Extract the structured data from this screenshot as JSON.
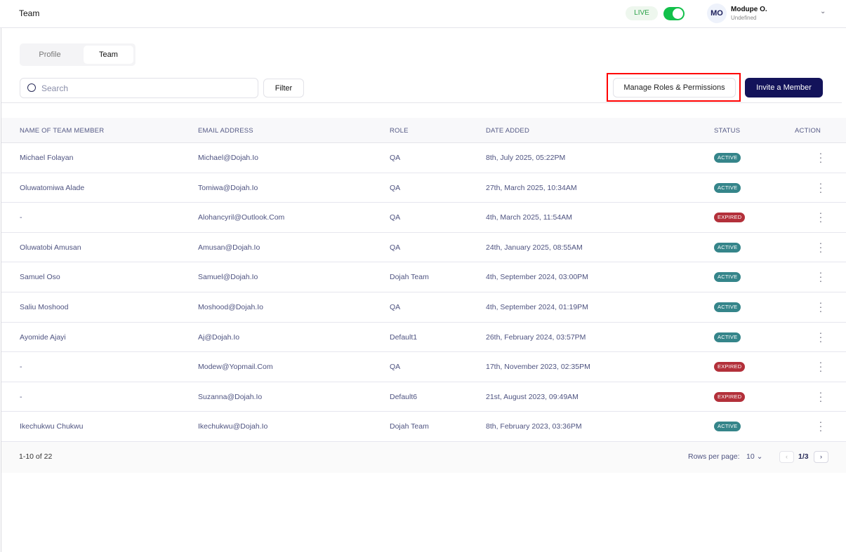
{
  "header": {
    "title": "Team",
    "env_label": "LIVE",
    "env_on": true,
    "user_initials": "MO",
    "user_name": "Modupe O.",
    "user_role": "Undefined"
  },
  "tabs": [
    {
      "label": "Profile",
      "active": false
    },
    {
      "label": "Team",
      "active": true
    }
  ],
  "toolbar": {
    "search_placeholder": "Search",
    "filter_label": "Filter",
    "manage_label": "Manage Roles & Permissions",
    "invite_label": "Invite a Member"
  },
  "table": {
    "columns": [
      "NAME OF TEAM MEMBER",
      "EMAIL ADDRESS",
      "ROLE",
      "DATE ADDED",
      "STATUS",
      "ACTION"
    ],
    "rows": [
      {
        "name": "Michael Folayan",
        "email": "Michael@Dojah.Io",
        "role": "QA",
        "date": "8th, July 2025, 05:22PM",
        "status": "ACTIVE"
      },
      {
        "name": "Oluwatomiwa Alade",
        "email": "Tomiwa@Dojah.Io",
        "role": "QA",
        "date": "27th, March 2025, 10:34AM",
        "status": "ACTIVE"
      },
      {
        "name": "-",
        "email": "Alohancyril@Outlook.Com",
        "role": "QA",
        "date": "4th, March 2025, 11:54AM",
        "status": "EXPIRED"
      },
      {
        "name": "Oluwatobi Amusan",
        "email": "Amusan@Dojah.Io",
        "role": "QA",
        "date": "24th, January 2025, 08:55AM",
        "status": "ACTIVE"
      },
      {
        "name": "Samuel Oso",
        "email": "Samuel@Dojah.Io",
        "role": "Dojah Team",
        "date": "4th, September 2024, 03:00PM",
        "status": "ACTIVE"
      },
      {
        "name": "Saliu Moshood",
        "email": "Moshood@Dojah.Io",
        "role": "QA",
        "date": "4th, September 2024, 01:19PM",
        "status": "ACTIVE"
      },
      {
        "name": "Ayomide Ajayi",
        "email": "Aj@Dojah.Io",
        "role": "Default1",
        "date": "26th, February 2024, 03:57PM",
        "status": "ACTIVE"
      },
      {
        "name": "-",
        "email": "Modew@Yopmail.Com",
        "role": "QA",
        "date": "17th, November 2023, 02:35PM",
        "status": "EXPIRED"
      },
      {
        "name": "-",
        "email": "Suzanna@Dojah.Io",
        "role": "Default6",
        "date": "21st, August 2023, 09:49AM",
        "status": "EXPIRED"
      },
      {
        "name": "Ikechukwu Chukwu",
        "email": "Ikechukwu@Dojah.Io",
        "role": "Dojah Team",
        "date": "8th, February 2023, 03:36PM",
        "status": "ACTIVE"
      }
    ]
  },
  "colors": {
    "ACTIVE": "#35858a",
    "EXPIRED": "#b3303a"
  },
  "footer": {
    "range": "1-10 of 22",
    "rows_per_page_label": "Rows per page:",
    "rows_per_page": "10 ⌄",
    "prev": "‹",
    "page": "1/3",
    "next": "›"
  }
}
